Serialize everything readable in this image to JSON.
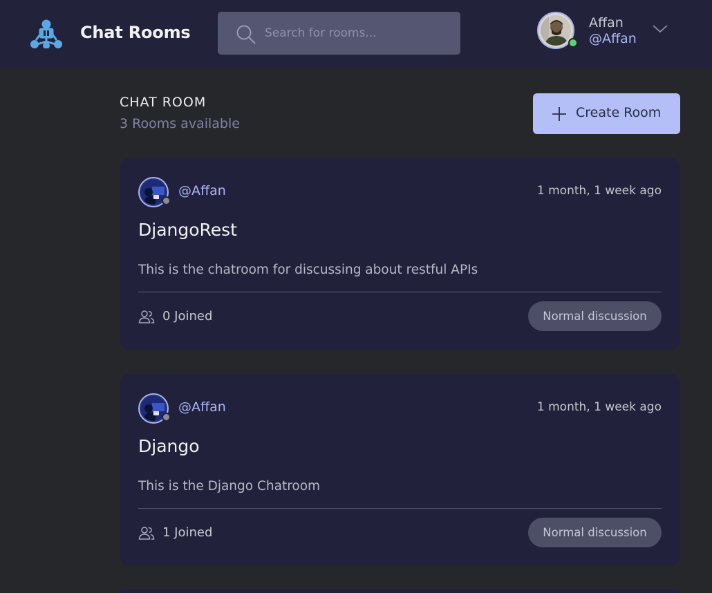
{
  "header": {
    "brand": "Chat Rooms",
    "search_placeholder": "Search for rooms...",
    "user": {
      "name": "Affan",
      "handle": "@Affan",
      "status": "online"
    }
  },
  "section": {
    "title": "CHAT ROOM",
    "subtitle": "3 Rooms available",
    "create_label": "Create Room"
  },
  "rooms": [
    {
      "host": "@Affan",
      "time": "1 month, 1 week ago",
      "title": "DjangoRest",
      "description": "This is the chatroom for discussing about restful APIs",
      "joined": "0 Joined",
      "topic": "Normal discussion"
    },
    {
      "host": "@Affan",
      "time": "1 month, 1 week ago",
      "title": "Django",
      "description": "This is the Django Chatroom",
      "joined": "1 Joined",
      "topic": "Normal discussion"
    }
  ],
  "colors": {
    "header_bg": "#22223a",
    "page_bg": "#26272b",
    "card_bg": "#21213b",
    "accent": "#b4bff7",
    "handle": "#a9b6f5",
    "online": "#5dd36b"
  }
}
